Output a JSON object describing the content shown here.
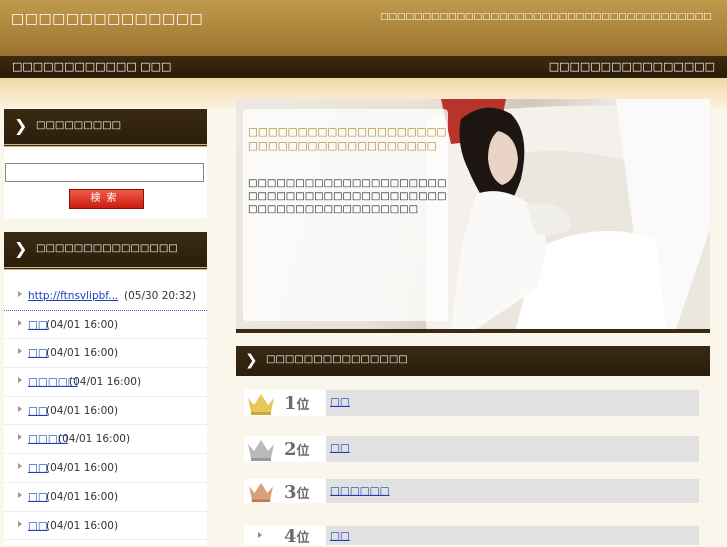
{
  "header": {
    "site_title": "□□□□□□□□□□□□□□",
    "description": "□□□□□□□□□□□□□□□□□□□□□□□□□□□□□□□□□□□□□□□"
  },
  "nav": {
    "left_text": "□□□□□□□□□□□□ □□□",
    "right_text": "□□□□□□□□□□□□□□□□"
  },
  "search": {
    "title": "□□□□□□□□□",
    "placeholder": "",
    "button_label": "検索"
  },
  "recent": {
    "title": "□□□□□□□□□□□□□□□",
    "items": [
      {
        "link": "http://ftnsvlipbf...",
        "time": "(05/30 20:32)"
      },
      {
        "link": "□□",
        "time": "(04/01 16:00)"
      },
      {
        "link": "□□",
        "time": "(04/01 16:00)"
      },
      {
        "link": "□□□□□",
        "time": "(04/01 16:00)"
      },
      {
        "link": "□□",
        "time": "(04/01 16:00)"
      },
      {
        "link": "□□□□",
        "time": "(04/01 16:00)"
      },
      {
        "link": "□□",
        "time": "(04/01 16:00)"
      },
      {
        "link": "□□",
        "time": "(04/01 16:00)"
      },
      {
        "link": "□□",
        "time": "(04/01 16:00)"
      }
    ]
  },
  "hero": {
    "title": "□□□□□□□□□□□□□□□□□□□□□□□□□□□□□□□□□□□□□□□",
    "text": "□□□□□□□□□□□□□□□□□□□□□□□□□□□□□□□□□□□□□□□□□□□□□□□□□□□□□□□□□□□□"
  },
  "ranking": {
    "title": "□□□□□□□□□□□□□□□",
    "rows": [
      {
        "rank": "1",
        "suffix": "位",
        "link": "□□",
        "crown_color": "#e8c65a"
      },
      {
        "rank": "2",
        "suffix": "位",
        "link": "□□",
        "crown_color": "#b9b9b9"
      },
      {
        "rank": "3",
        "suffix": "位",
        "link": "□□□□□□",
        "crown_color": "#d9a07c"
      },
      {
        "rank": "4",
        "suffix": "位",
        "link": "□□",
        "crown_color": ""
      }
    ]
  }
}
